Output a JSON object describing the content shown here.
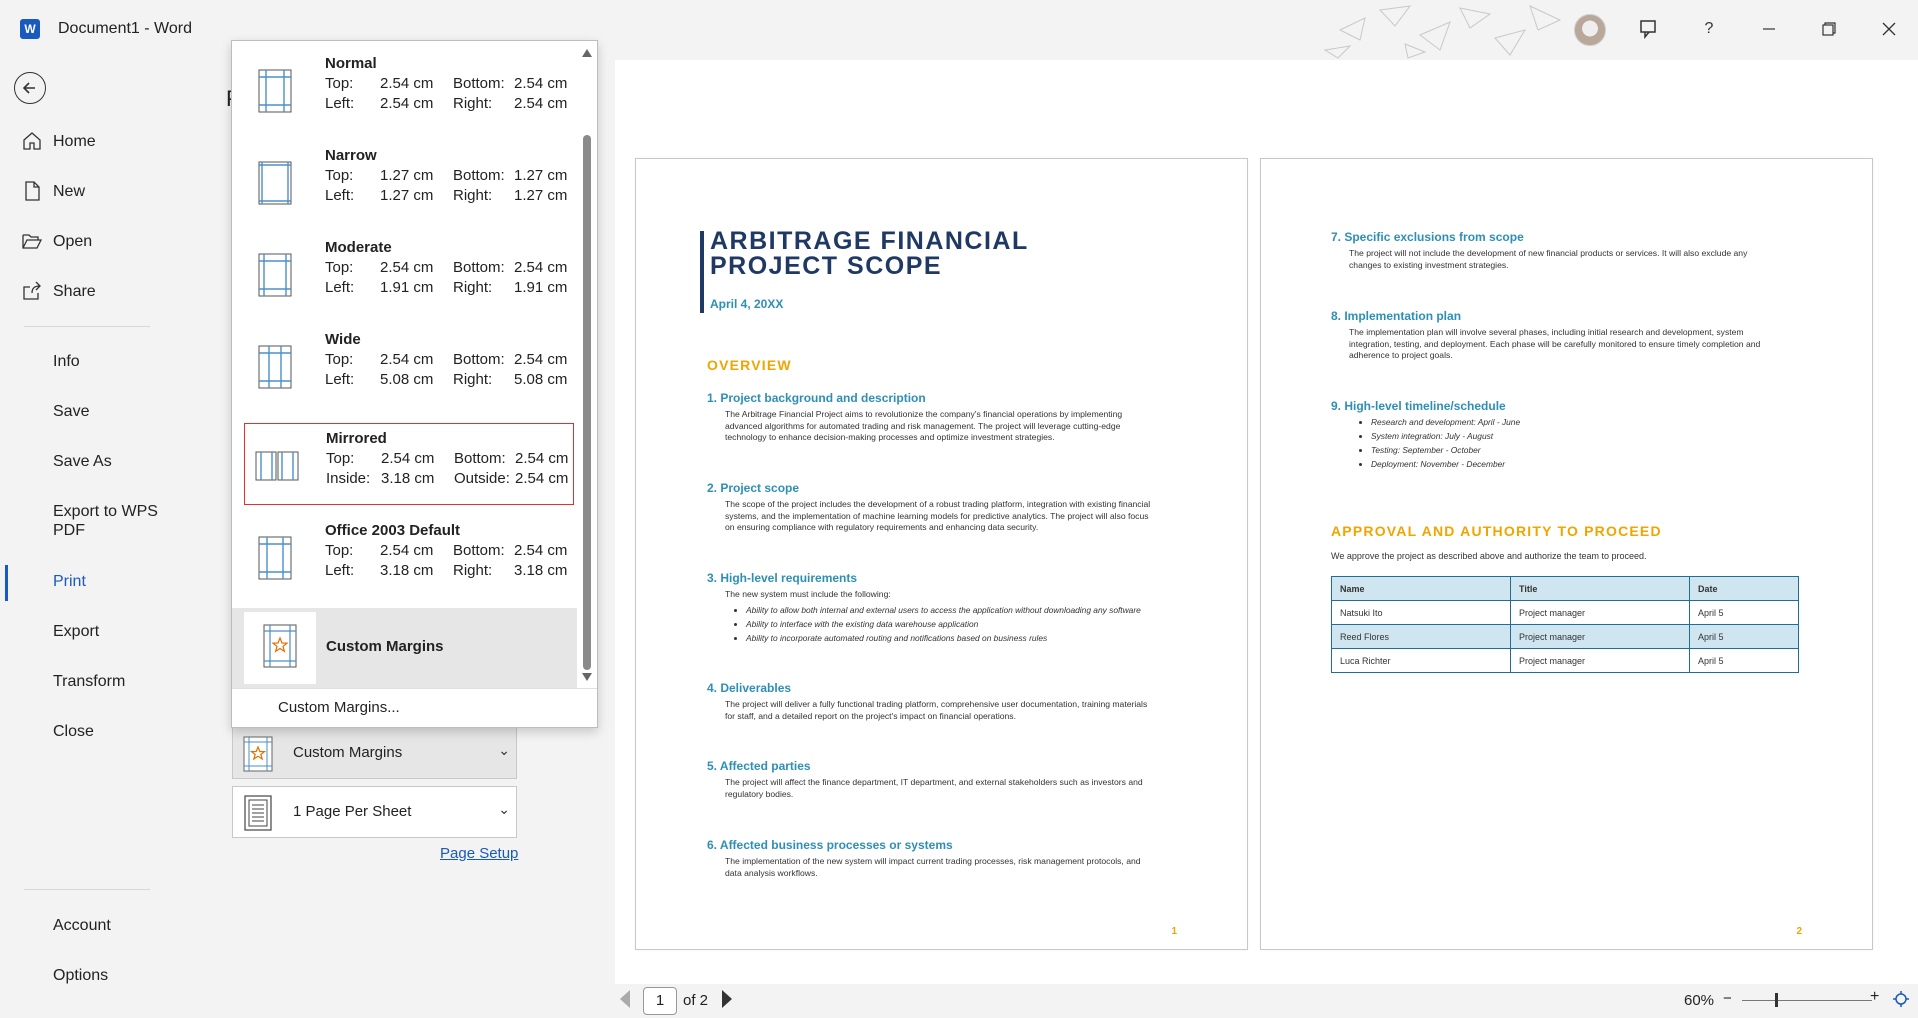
{
  "titlebar": {
    "app_name": "Word",
    "document_title": "Document1  -  Word",
    "help": "?"
  },
  "nav": {
    "items": [
      {
        "label": "Home",
        "icon": "home-icon"
      },
      {
        "label": "New",
        "icon": "new-document-icon"
      },
      {
        "label": "Open",
        "icon": "folder-open-icon"
      },
      {
        "label": "Share",
        "icon": "share-icon"
      },
      {
        "label": "Info"
      },
      {
        "label": "Save"
      },
      {
        "label": "Save As"
      },
      {
        "label": "Export to WPS PDF"
      },
      {
        "label": "Print"
      },
      {
        "label": "Export"
      },
      {
        "label": "Transform"
      },
      {
        "label": "Close"
      },
      {
        "label": "Account"
      },
      {
        "label": "Options"
      }
    ],
    "active": "Print"
  },
  "settings": {
    "heading": "P",
    "margins_selected": "Custom Margins",
    "pages_per_sheet": "1 Page Per Sheet",
    "page_setup_link": "Page Setup"
  },
  "margins_popup": {
    "options": [
      {
        "name": "Normal",
        "k1": "Top:",
        "v1": "2.54 cm",
        "k2": "Bottom:",
        "v2": "2.54 cm",
        "k3": "Left:",
        "v3": "2.54 cm",
        "k4": "Right:",
        "v4": "2.54 cm"
      },
      {
        "name": "Narrow",
        "k1": "Top:",
        "v1": "1.27 cm",
        "k2": "Bottom:",
        "v2": "1.27 cm",
        "k3": "Left:",
        "v3": "1.27 cm",
        "k4": "Right:",
        "v4": "1.27 cm"
      },
      {
        "name": "Moderate",
        "k1": "Top:",
        "v1": "2.54 cm",
        "k2": "Bottom:",
        "v2": "2.54 cm",
        "k3": "Left:",
        "v3": "1.91 cm",
        "k4": "Right:",
        "v4": "1.91 cm"
      },
      {
        "name": "Wide",
        "k1": "Top:",
        "v1": "2.54 cm",
        "k2": "Bottom:",
        "v2": "2.54 cm",
        "k3": "Left:",
        "v3": "5.08 cm",
        "k4": "Right:",
        "v4": "5.08 cm"
      },
      {
        "name": "Mirrored",
        "k1": "Top:",
        "v1": "2.54 cm",
        "k2": "Bottom:",
        "v2": "2.54 cm",
        "k3": "Inside:",
        "v3": "3.18 cm",
        "k4": "Outside:",
        "v4": "2.54 cm"
      },
      {
        "name": "Office 2003 Default",
        "k1": "Top:",
        "v1": "2.54 cm",
        "k2": "Bottom:",
        "v2": "2.54 cm",
        "k3": "Left:",
        "v3": "3.18 cm",
        "k4": "Right:",
        "v4": "3.18 cm"
      }
    ],
    "custom_option": "Custom Margins",
    "custom_link": "Custom Margins..."
  },
  "page1": {
    "title": "ARBITRAGE FINANCIAL PROJECT SCOPE",
    "date": "April 4, 20XX",
    "section": "OVERVIEW",
    "items": [
      {
        "h": "1.  Project background and description",
        "p": "The Arbitrage Financial Project aims to revolutionize the company's financial operations by implementing advanced algorithms for automated trading and risk management. The project will leverage cutting-edge technology to enhance decision-making processes and optimize investment strategies."
      },
      {
        "h": "2.  Project scope",
        "p": "The scope of the project includes the development of a robust trading platform, integration with existing financial systems, and the implementation of machine learning models for predictive analytics. The project will also focus on ensuring compliance with regulatory requirements and enhancing data security."
      },
      {
        "h": "3.  High-level requirements",
        "p": "The new system must include the following:"
      },
      {
        "h": "4.  Deliverables",
        "p": "The project will deliver a fully functional trading platform, comprehensive user documentation, training materials for staff, and a detailed report on the project's impact on financial operations."
      },
      {
        "h": "5.   Affected parties",
        "p": "The project will affect the finance department, IT department, and external stakeholders such as investors and regulatory bodies."
      },
      {
        "h": "6.  Affected business processes or systems",
        "p": "The implementation of the new system will impact current trading processes, risk management protocols, and data analysis workflows."
      }
    ],
    "bullets": [
      "Ability to allow both internal and external users to access the application without downloading any software",
      "Ability to interface with the existing data warehouse application",
      "Ability to incorporate automated routing and notifications based on business rules"
    ],
    "page_number": "1"
  },
  "page2": {
    "items": [
      {
        "h": "7.  Specific exclusions from scope",
        "p": "The project will not include the development of new financial products or services. It will also exclude any changes to existing investment strategies."
      },
      {
        "h": "8.  Implementation plan",
        "p": "The implementation plan will involve several phases, including initial research and development, system integration, testing, and deployment. Each phase will be carefully monitored to ensure timely completion and adherence to project goals."
      },
      {
        "h": "9.  High-level timeline/schedule",
        "p": ""
      }
    ],
    "timeline": [
      "Research and development: April - June",
      "System integration: July - August",
      "Testing: September - October",
      "Deployment: November - December"
    ],
    "section": "APPROVAL AND AUTHORITY TO PROCEED",
    "approval_text": "We approve the project as described above and authorize the team to proceed.",
    "table": {
      "headers": [
        "Name",
        "Title",
        "Date"
      ],
      "rows": [
        [
          "Natsuki Ito",
          "Project manager",
          "April 5"
        ],
        [
          "Reed Flores",
          "Project manager",
          "April 5"
        ],
        [
          "Luca Richter",
          "Project manager",
          "April 5"
        ]
      ]
    },
    "page_number": "2"
  },
  "status": {
    "current_page": "1",
    "of_pages": "of 2",
    "zoom": "60%",
    "zoom_minus": "−",
    "zoom_plus": "+"
  },
  "colors": {
    "accent": "#185abd",
    "doc_title": "#1f3864",
    "doc_heading": "#2e8fb5",
    "doc_section": "#f0a500",
    "selection": "#e03030"
  }
}
